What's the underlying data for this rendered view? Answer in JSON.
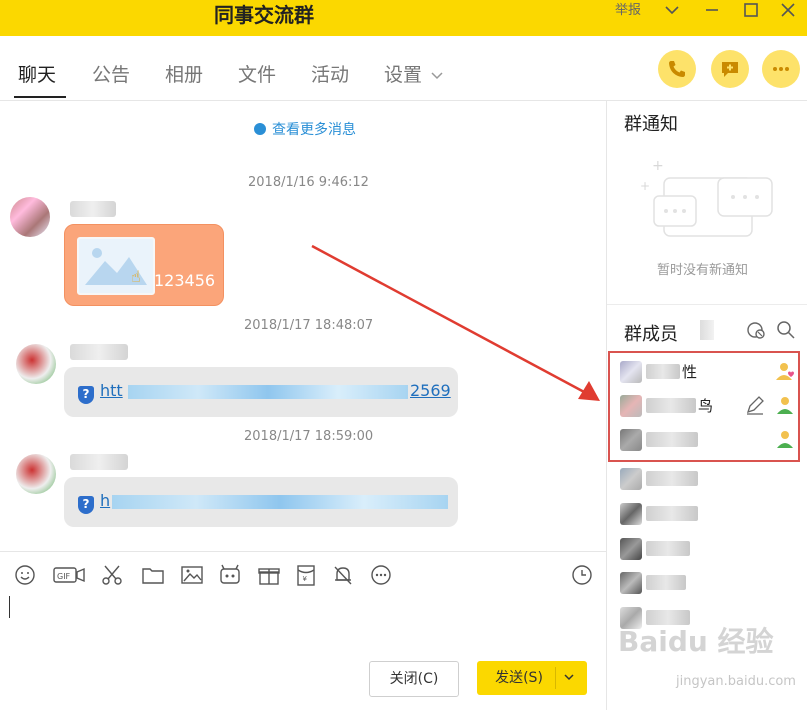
{
  "window": {
    "title": "同事交流群",
    "report_label": "举报"
  },
  "tabs": [
    {
      "label": "聊天"
    },
    {
      "label": "公告"
    },
    {
      "label": "相册"
    },
    {
      "label": "文件"
    },
    {
      "label": "活动"
    },
    {
      "label": "设置"
    }
  ],
  "chat": {
    "more_messages": "查看更多消息",
    "messages": [
      {
        "time": "2018/1/16 9:46:12",
        "image_caption": "123456"
      },
      {
        "time": "2018/1/17 18:48:07",
        "link_prefix": "htt",
        "link_suffix": "2569"
      },
      {
        "time": "2018/1/17 18:59:00",
        "link_prefix": "h"
      }
    ]
  },
  "toolbar": {
    "icons": [
      "emoji-icon",
      "gif-icon",
      "scissors-icon",
      "folder-icon",
      "image-icon",
      "screen-capture-icon",
      "gift-icon",
      "red-packet-icon",
      "bell-off-icon",
      "more-icon"
    ],
    "history_icon": "clock-icon"
  },
  "actions": {
    "close_label": "关闭(C)",
    "send_label": "发送(S)"
  },
  "notice": {
    "title": "群通知",
    "empty_text": "暂时没有新通知"
  },
  "members": {
    "title": "群成员",
    "list": [
      {
        "suffix": "性"
      },
      {
        "suffix": "鸟"
      },
      {
        "suffix": ""
      },
      {
        "suffix": ""
      },
      {
        "suffix": ""
      },
      {
        "suffix": ""
      },
      {
        "suffix": ""
      },
      {
        "suffix": ""
      }
    ]
  },
  "watermark": {
    "brand": "Baidu 经验",
    "url": "jingyan.baidu.com"
  },
  "colors": {
    "accent": "#fbd800",
    "link": "#1f6fbd",
    "highlight": "#d9534f"
  }
}
